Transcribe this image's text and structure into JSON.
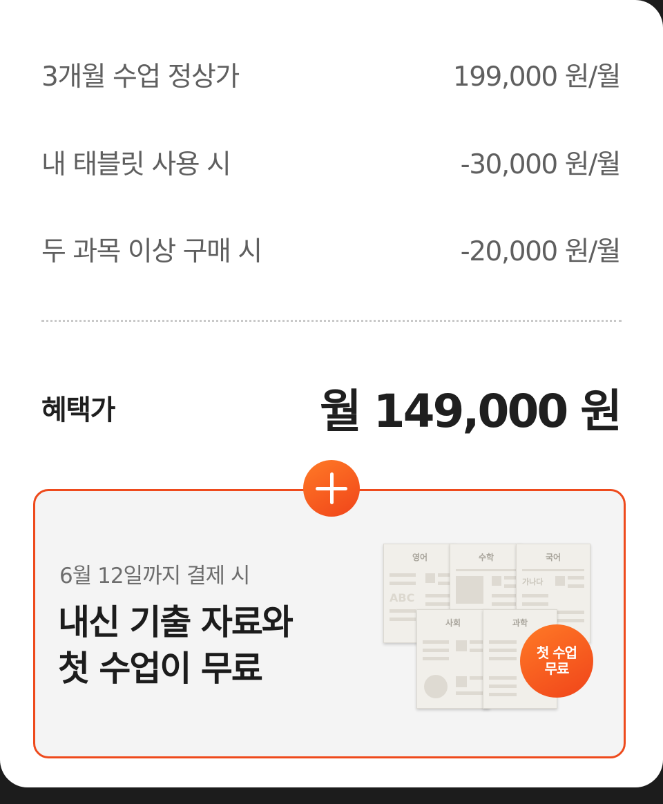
{
  "pricing": {
    "rows": [
      {
        "label": "3개월 수업 정상가",
        "value": "199,000 원/월"
      },
      {
        "label": "내 태블릿 사용 시",
        "value": "-30,000 원/월"
      },
      {
        "label": "두 과목 이상 구매 시",
        "value": "-20,000 원/월"
      }
    ],
    "total_label": "혜택가",
    "total_value": "월 149,000 원"
  },
  "promo": {
    "subtitle": "6월 12일까지 결제 시",
    "title_line1": "내신 기출 자료와",
    "title_line2": "첫 수업이 무료",
    "badge_line1": "첫 수업",
    "badge_line2": "무료",
    "sheets": {
      "english": "영어",
      "math": "수학",
      "korean": "국어",
      "social": "사회",
      "science": "과학",
      "english_sample": "ABC",
      "korean_sample": "가나다"
    }
  },
  "colors": {
    "accent": "#ee4a1c",
    "text_primary": "#1f1f1f",
    "text_secondary": "#5f5f5f",
    "promo_bg": "#f4f4f4"
  },
  "icons": {
    "plus_badge": "plus-icon"
  }
}
